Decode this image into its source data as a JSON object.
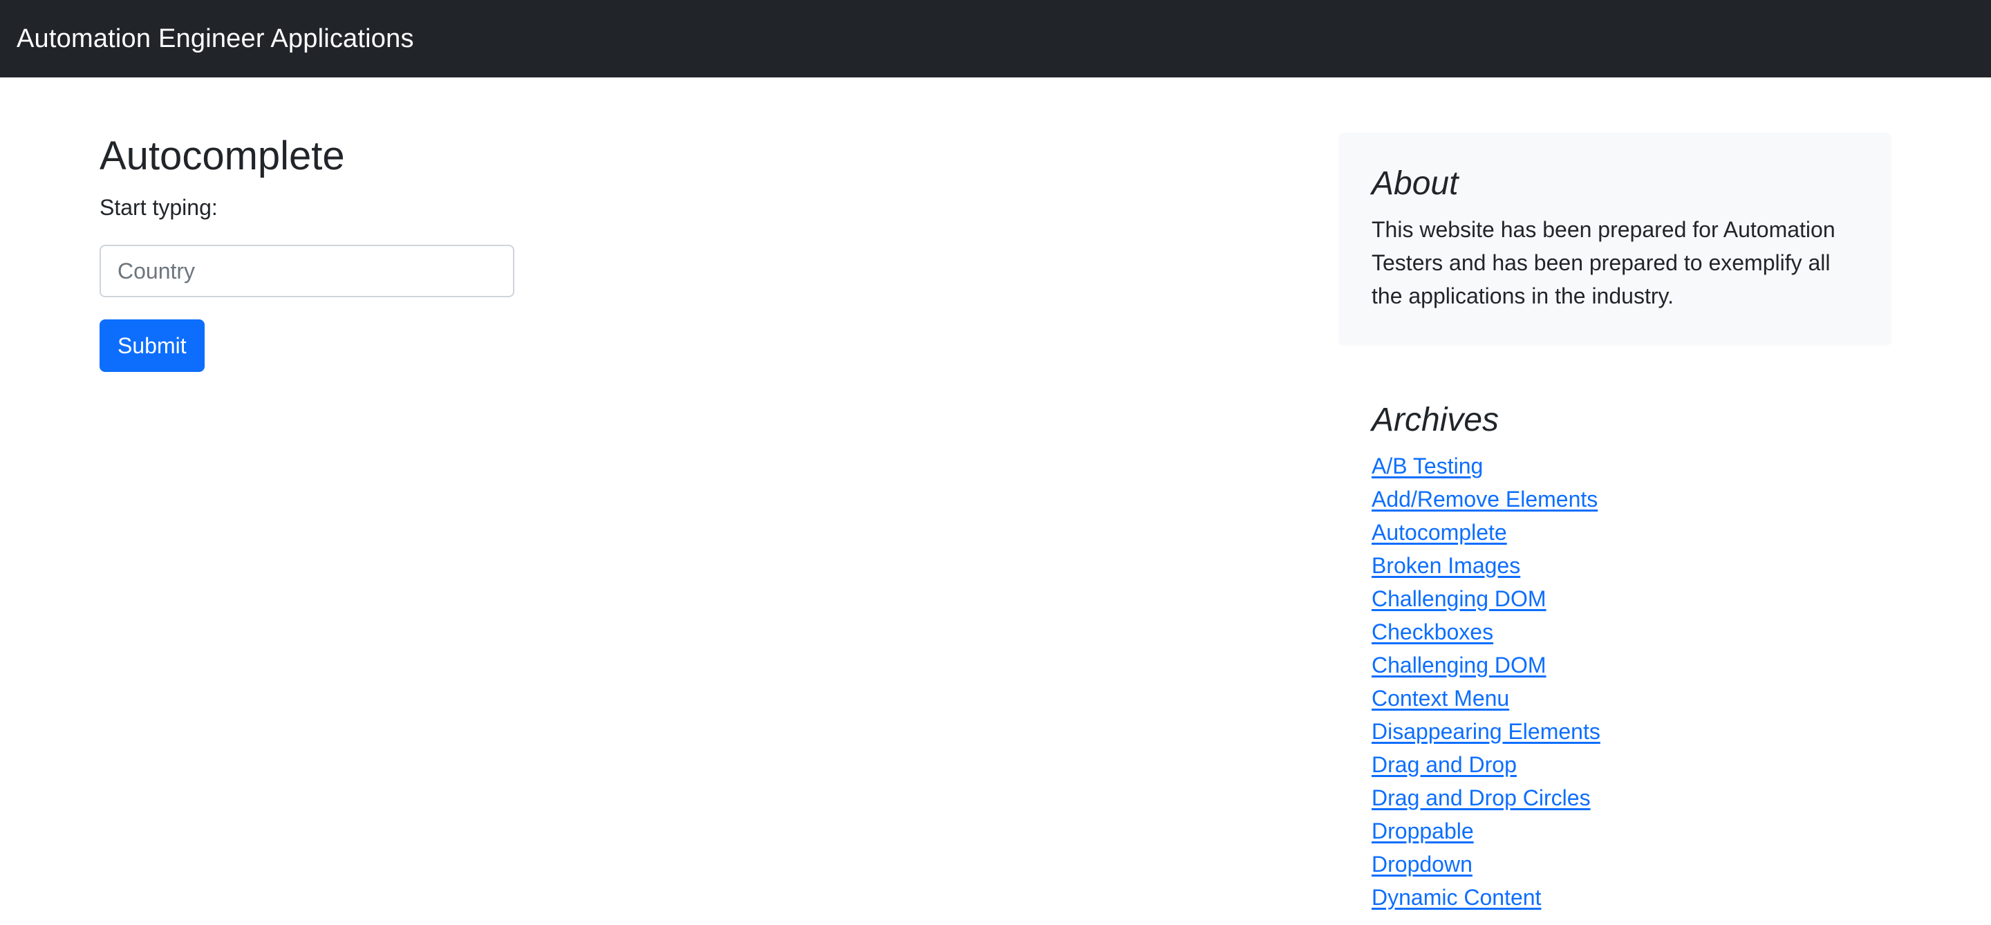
{
  "navbar": {
    "brand": "Automation Engineer Applications"
  },
  "main": {
    "title": "Autocomplete",
    "label": "Start typing:",
    "input": {
      "value": "",
      "placeholder": "Country"
    },
    "submit_label": "Submit"
  },
  "sidebar": {
    "about": {
      "heading": "About",
      "text": "This website has been prepared for Automation Testers and has been prepared to exemplify all the applications in the industry."
    },
    "archives": {
      "heading": "Archives",
      "links": [
        "A/B Testing",
        "Add/Remove Elements",
        "Autocomplete",
        "Broken Images",
        "Challenging DOM",
        "Checkboxes",
        "Challenging DOM",
        "Context Menu",
        "Disappearing Elements",
        "Drag and Drop",
        "Drag and Drop Circles",
        "Droppable",
        "Dropdown",
        "Dynamic Content"
      ]
    }
  },
  "colors": {
    "navbar_bg": "#212529",
    "primary": "#0d6efd",
    "about_bg": "#f8f9fa",
    "text": "#212529"
  }
}
